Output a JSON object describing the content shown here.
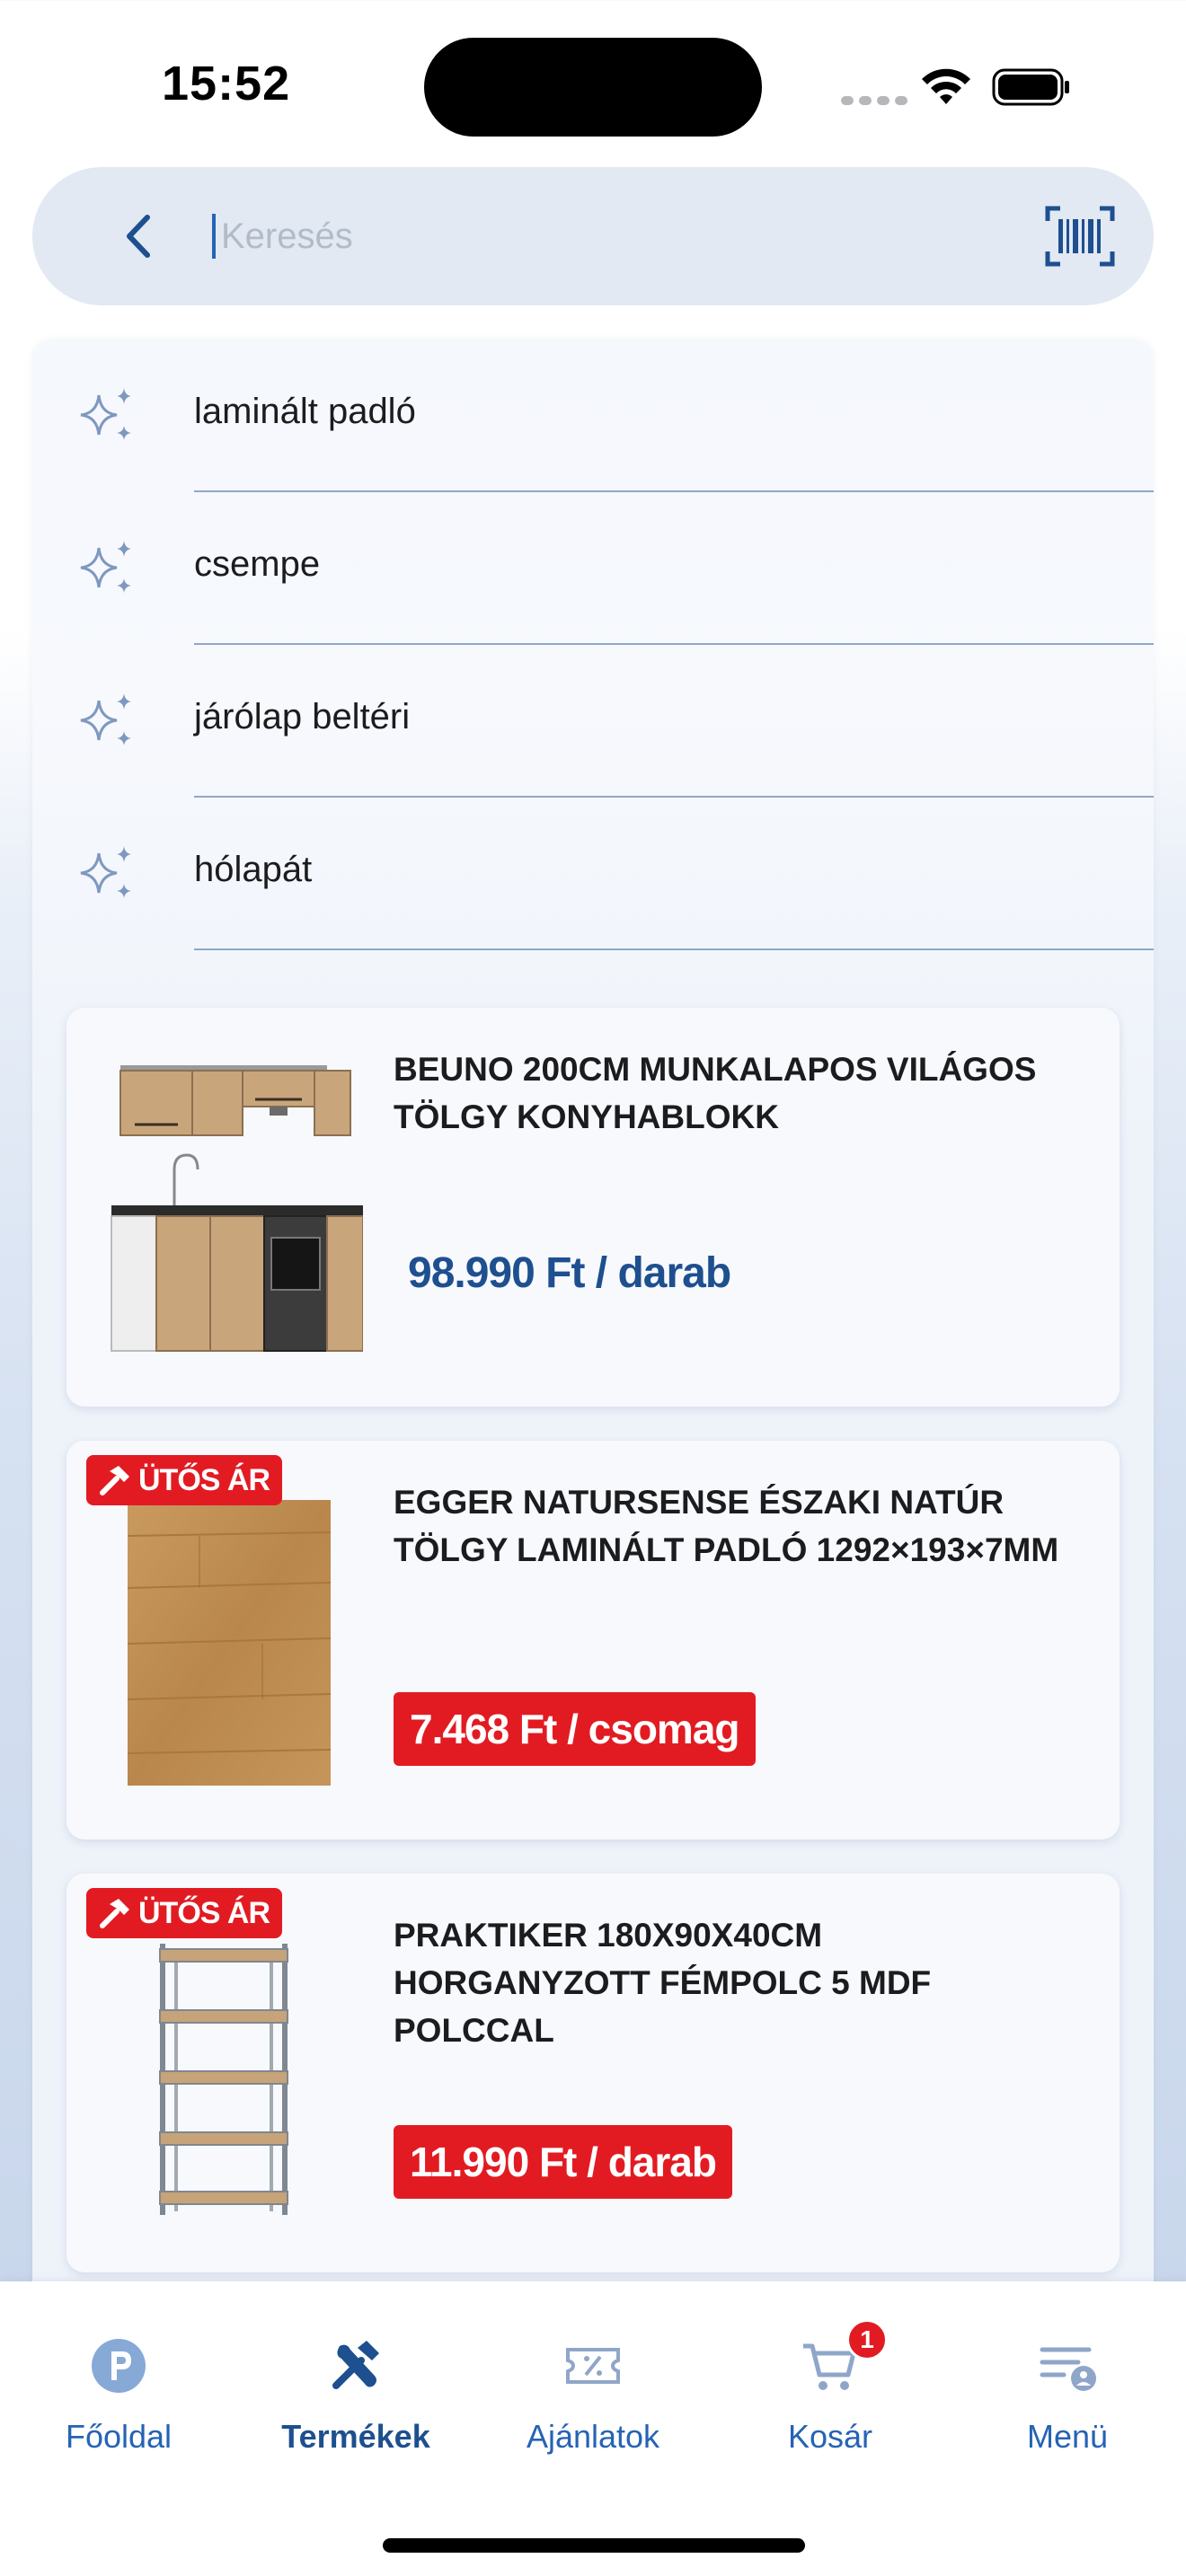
{
  "status_bar": {
    "time": "15:52"
  },
  "search": {
    "placeholder": "Keresés",
    "value": ""
  },
  "suggestions": [
    {
      "label": "laminált padló"
    },
    {
      "label": "csempe"
    },
    {
      "label": "járólap beltéri"
    },
    {
      "label": "hólapát"
    }
  ],
  "products": [
    {
      "title": "BEUNO 200CM MUNKALAPOS VILÁGOS TÖLGY KONYHABLOKK",
      "price": "98.990 Ft / darab",
      "price_style": "regular",
      "badge": ""
    },
    {
      "title": "EGGER NATURSENSE ÉSZAKI NATÚR TÖLGY LAMINÁLT PADLÓ 1292×193×7MM",
      "price": "7.468 Ft / csomag",
      "price_style": "promo",
      "badge": "ÜTŐS ÁR"
    },
    {
      "title": "PRAKTIKER 180X90X40CM HORGANYZOTT FÉMPOLC 5 MDF POLCCAL",
      "price": "11.990 Ft / darab",
      "price_style": "promo",
      "badge": "ÜTŐS ÁR"
    }
  ],
  "tab_bar": {
    "tabs": [
      {
        "label": "Főoldal",
        "icon": "praktiker-logo-icon",
        "active": false
      },
      {
        "label": "Termékek",
        "icon": "tools-icon",
        "active": true
      },
      {
        "label": "Ajánlatok",
        "icon": "coupon-icon",
        "active": false
      },
      {
        "label": "Kosár",
        "icon": "cart-icon",
        "active": false,
        "badge": "1"
      },
      {
        "label": "Menü",
        "icon": "menu-profile-icon",
        "active": false
      }
    ]
  },
  "colors": {
    "brand_blue": "#1e4f8f",
    "accent_blue": "#2563b5",
    "promo_red": "#e21b23"
  }
}
